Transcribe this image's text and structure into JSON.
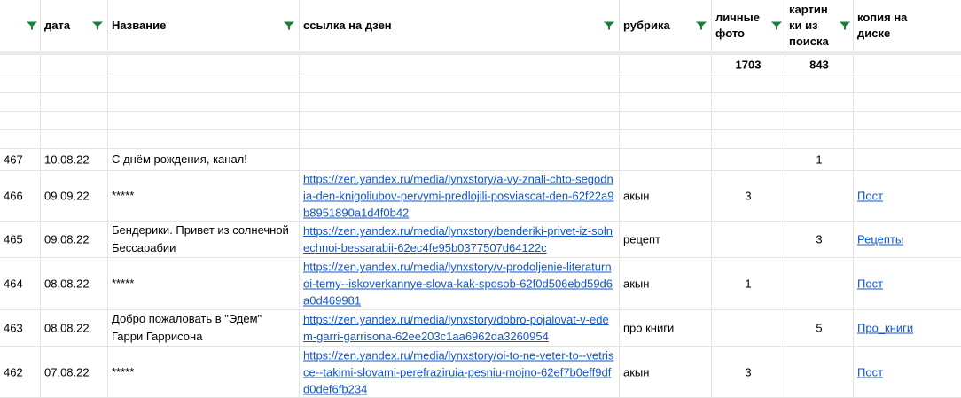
{
  "headers": [
    {
      "label": ""
    },
    {
      "label": "дата"
    },
    {
      "label": "Название"
    },
    {
      "label": "ссылка на дзен"
    },
    {
      "label": "рубрика"
    },
    {
      "label": "личные фото"
    },
    {
      "label": "картин ки из поиска"
    },
    {
      "label": "копия на диске"
    }
  ],
  "totals": {
    "photos": "1703",
    "search": "843"
  },
  "rows": [
    {
      "num": "467",
      "date": "10.08.22",
      "title": "С днём рождения, канал!",
      "link": "",
      "rubric": "",
      "photos": "",
      "search": "1",
      "copy": ""
    },
    {
      "num": "466",
      "date": "09.09.22",
      "title": "*****",
      "link": "https://zen.yandex.ru/media/lynxstory/a-vy-znali-chto-segodnia-den-knigoliubov-pervymi-predlojili-posviascat-den-62f22a9b8951890a1d4f0b42",
      "rubric": "акын",
      "photos": "3",
      "search": "",
      "copy": "Пост"
    },
    {
      "num": "465",
      "date": "09.08.22",
      "title": "Бендерики. Привет из солнечной Бессарабии",
      "link": "https://zen.yandex.ru/media/lynxstory/benderiki-privet-iz-solnechnoi-bessarabii-62ec4fe95b0377507d64122c",
      "rubric": "рецепт",
      "photos": "",
      "search": "3",
      "copy": "Рецепты"
    },
    {
      "num": "464",
      "date": "08.08.22",
      "title": "*****",
      "link": "https://zen.yandex.ru/media/lynxstory/v-prodoljenie-literaturnoi-temy--iskoverkannye-slova-kak-sposob-62f0d506ebd59d6a0d469981",
      "rubric": "акын",
      "photos": "1",
      "search": "",
      "copy": "Пост"
    },
    {
      "num": "463",
      "date": "08.08.22",
      "title": "Добро пожаловать в \"Эдем\" Гарри Гаррисона",
      "link": "https://zen.yandex.ru/media/lynxstory/dobro-pojalovat-v-edem-garri-garrisona-62ee203c1aa6962da3260954",
      "rubric": "про книги",
      "photos": "",
      "search": "5",
      "copy": "Про_книги"
    },
    {
      "num": "462",
      "date": "07.08.22",
      "title": "*****",
      "link": "https://zen.yandex.ru/media/lynxstory/oi-to-ne-veter-to--vetrisce--takimi-slovami-perefraziruia-pesniu-mojno-62ef7b0eff9dfd0def6fb234",
      "rubric": "акын",
      "photos": "3",
      "search": "",
      "copy": "Пост"
    }
  ]
}
